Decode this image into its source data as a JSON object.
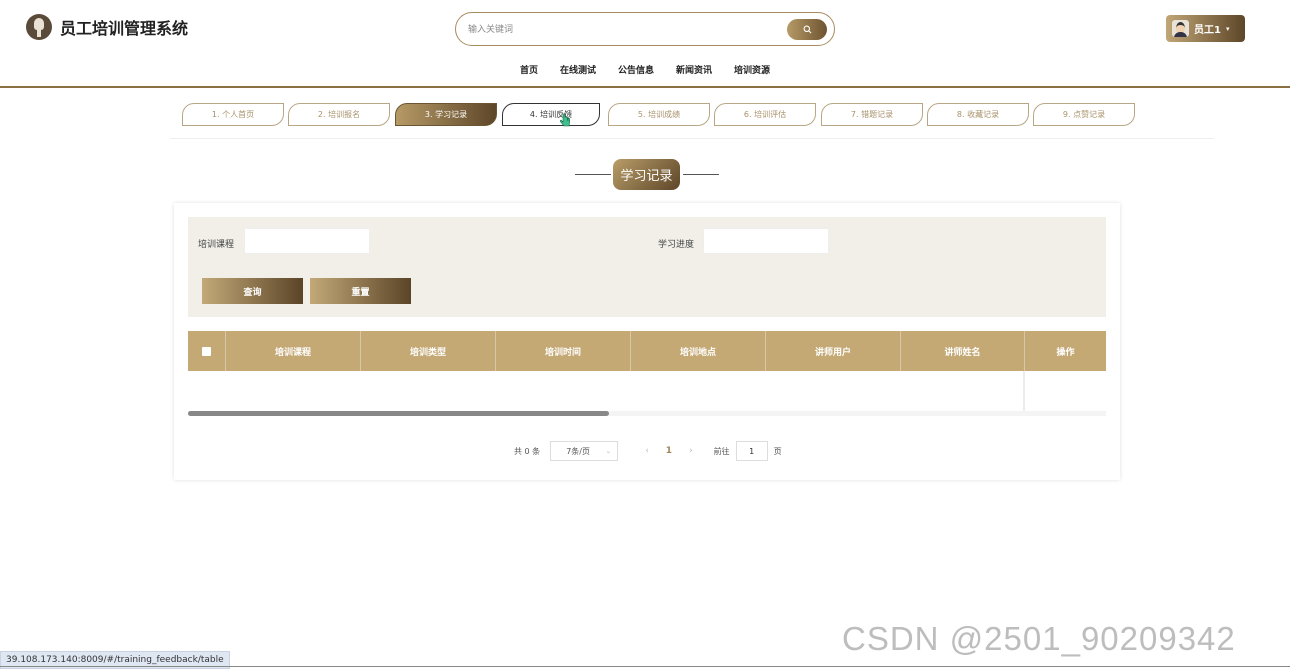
{
  "app": {
    "title": "员工培训管理系统",
    "logo_icon": "mic-icon"
  },
  "search": {
    "placeholder": "输入关键词"
  },
  "user": {
    "name": "员工1",
    "caret": "▾"
  },
  "nav": [
    "首页",
    "在线测试",
    "公告信息",
    "新闻资讯",
    "培训资源"
  ],
  "tabs": [
    {
      "label": "1. 个人首页"
    },
    {
      "label": "2. 培训报名"
    },
    {
      "label": "3. 学习记录",
      "active": true
    },
    {
      "label": "4. 培训反馈",
      "hover": true
    },
    {
      "label": "5. 培训成绩"
    },
    {
      "label": "6. 培训评估"
    },
    {
      "label": "7. 错题记录"
    },
    {
      "label": "8. 收藏记录"
    },
    {
      "label": "9. 点赞记录"
    }
  ],
  "section": {
    "title": "学习记录"
  },
  "filter": {
    "course_label": "培训课程",
    "progress_label": "学习进度",
    "query_button": "查询",
    "reset_button": "重置"
  },
  "table": {
    "columns": [
      "培训课程",
      "培训类型",
      "培训时间",
      "培训地点",
      "讲师用户",
      "讲师姓名",
      "操作"
    ],
    "rows": []
  },
  "pagination": {
    "total": "共 0 条",
    "page_size": "7条/页",
    "current_page": "1",
    "goto_prefix": "前往",
    "goto_value": "1",
    "goto_suffix": "页"
  },
  "status_bar": {
    "url": "39.108.173.140:8009/#/training_feedback/table"
  },
  "watermark": "CSDN @2501_90209342",
  "colors": {
    "accent": "#8a6f43",
    "header_gold": "#c4a975",
    "filter_bg": "#f1efe8"
  }
}
